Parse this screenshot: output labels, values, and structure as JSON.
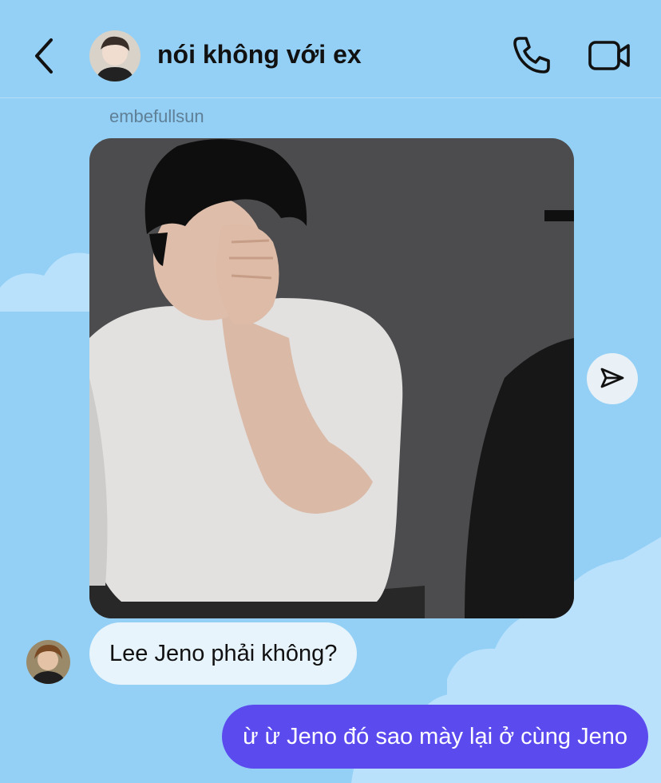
{
  "header": {
    "back_icon": "chevron-left-icon",
    "contact_name": "nói không với ex",
    "call_icon": "phone-icon",
    "video_icon": "video-camera-icon"
  },
  "thread": {
    "sender_username": "embefullsun",
    "photo_message": {
      "kind": "photo",
      "share_icon": "paper-plane-icon"
    },
    "messages": [
      {
        "direction": "incoming",
        "text": "Lee Jeno phải không?"
      },
      {
        "direction": "outgoing",
        "text": "ừ ừ Jeno đó sao mày lại ở cùng Jeno"
      }
    ]
  },
  "colors": {
    "background": "#94d0f6",
    "cloud": "#b9e1fb",
    "incoming_bubble": "#e8f4fc",
    "outgoing_bubble": "#5b4bef",
    "title_text": "#111111",
    "sender_label": "#5f7f96"
  }
}
